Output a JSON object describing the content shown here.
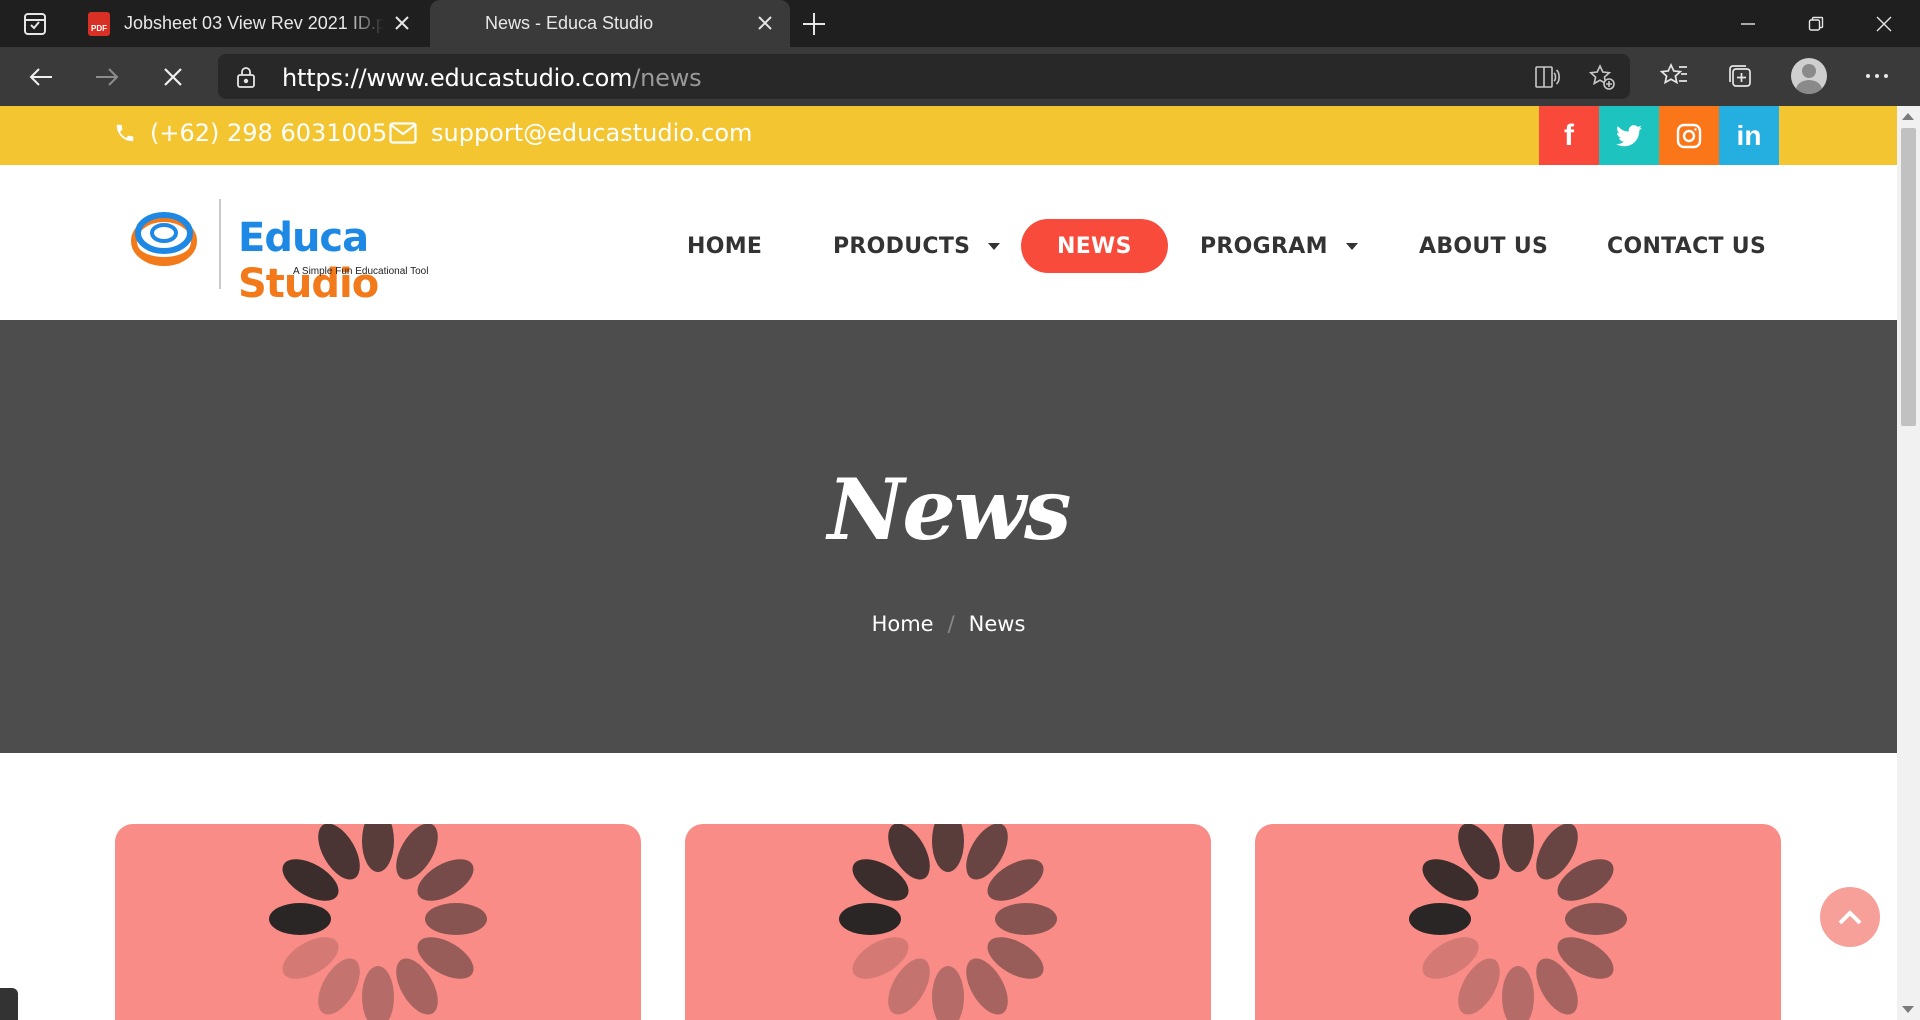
{
  "browser": {
    "tabs": [
      {
        "label": "Jobsheet 03 View Rev 2021 ID.pdf",
        "icon": "pdf-icon",
        "icon_text": "PDF"
      },
      {
        "label": "News - Educa Studio",
        "active": true
      }
    ],
    "url_host": "https://www.educastudio.com",
    "url_path": "/news",
    "reload_state": "stop-loading"
  },
  "topbar": {
    "phone": "(+62) 298 6031005",
    "email": "support@educastudio.com",
    "social": [
      {
        "name": "facebook",
        "glyph": "f",
        "color": "#f8493b"
      },
      {
        "name": "twitter",
        "color": "#1cc3bf"
      },
      {
        "name": "instagram",
        "color": "#fb7519"
      },
      {
        "name": "linkedin",
        "glyph": "in",
        "color": "#25aee0"
      }
    ]
  },
  "logo": {
    "word1": "Educa",
    "word2": "Studio",
    "tagline": "A Simple Fun Educational Tool"
  },
  "nav": {
    "items": [
      "HOME",
      "PRODUCTS",
      "NEWS",
      "PROGRAM",
      "ABOUT US",
      "CONTACT US"
    ],
    "active": "NEWS"
  },
  "hero": {
    "title": "News",
    "breadcrumb": [
      "Home",
      "News"
    ],
    "separator": "/"
  },
  "colors": {
    "accent_yellow": "#f3c531",
    "accent_red": "#f84b3b",
    "hero_bg": "#4d4d4d",
    "card_bg": "#f98c86"
  }
}
